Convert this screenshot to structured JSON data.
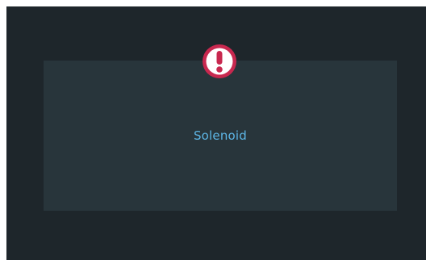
{
  "panel": {
    "label": "Solenoid"
  },
  "alert": {
    "icon": "exclamation-circle-icon",
    "color": "#c8284f"
  },
  "colors": {
    "background": "#1e262b",
    "panel": "#28353b",
    "label": "#5db6e6"
  }
}
